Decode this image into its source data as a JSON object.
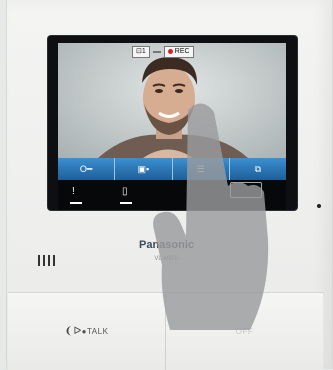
{
  "screen": {
    "status": {
      "channel": "1",
      "badge": "",
      "rec_label": "REC"
    },
    "softkeys": [
      {
        "icon": "key-icon",
        "label": "O━"
      },
      {
        "icon": "split-screen-icon",
        "label": "▣▪"
      },
      {
        "icon": "menu-list-icon",
        "label": "☰"
      },
      {
        "icon": "fullscreen-icon",
        "label": "⧉"
      }
    ],
    "bottom_icons": [
      {
        "icon": "alert-icon",
        "label": "!"
      },
      {
        "icon": "document-icon",
        "label": "▯"
      }
    ]
  },
  "device": {
    "brand": "Panasonic",
    "model": "VL-MWD",
    "talk_label": "●TALK",
    "off_label": "OFF"
  },
  "colors": {
    "softkey_blue": "#2a74b5",
    "rec_red": "#e02020",
    "badge_yellow": "#f3d400"
  }
}
